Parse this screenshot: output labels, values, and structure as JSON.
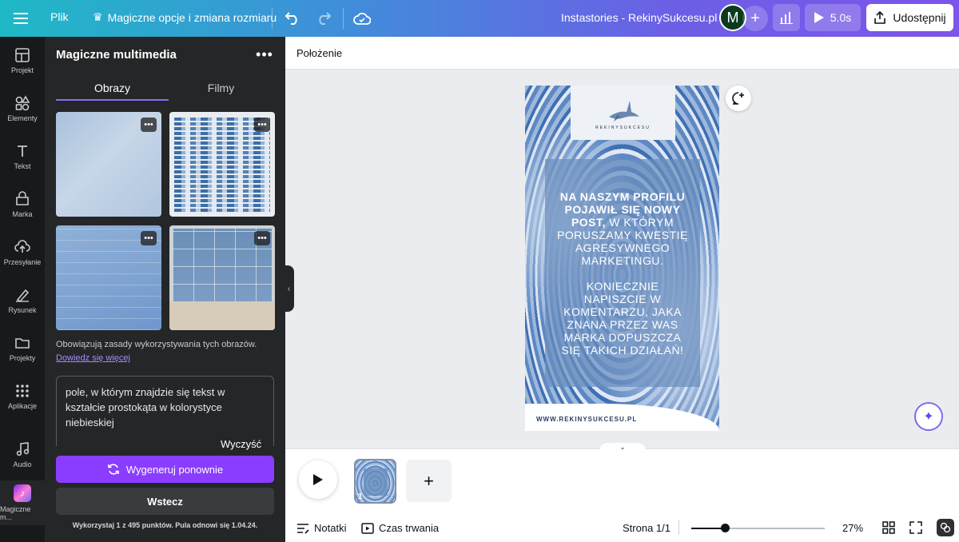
{
  "topbar": {
    "file_label": "Plik",
    "magic_label": "Magiczne opcje i zmiana rozmiaru",
    "doc_title": "Instastories - RekinySukcesu.pl",
    "avatar_initial": "M",
    "play_duration": "5.0s",
    "share_label": "Udostępnij"
  },
  "rail": {
    "items": [
      {
        "label": "Projekt",
        "icon": "layout-icon"
      },
      {
        "label": "Elementy",
        "icon": "shapes-icon"
      },
      {
        "label": "Tekst",
        "icon": "text-icon"
      },
      {
        "label": "Marka",
        "icon": "brand-icon"
      },
      {
        "label": "Przesyłanie",
        "icon": "upload-icon"
      },
      {
        "label": "Rysunek",
        "icon": "draw-icon"
      },
      {
        "label": "Projekty",
        "icon": "folder-icon"
      },
      {
        "label": "Aplikacje",
        "icon": "apps-icon"
      },
      {
        "label": "Audio",
        "icon": "music-icon"
      },
      {
        "label": "Magiczne m...",
        "icon": "magic-media-icon"
      }
    ]
  },
  "panel": {
    "title": "Magiczne multimedia",
    "tabs": [
      "Obrazy",
      "Filmy"
    ],
    "active_tab": "Obrazy",
    "notice": "Obowiązują zasady wykorzystywania tych obrazów.",
    "learn_more": "Dowiedz się więcej",
    "prompt": "pole, w którym znajdzie się tekst w kształcie prostokąta w kolorystyce niebieskiej",
    "clear_label": "Wyczyść",
    "regenerate_label": "Wygeneruj ponownie",
    "back_label": "Wstecz",
    "credits": "Wykorzystaj 1 z 495 punktów. Pula odnowi się 1.04.24."
  },
  "context_bar": {
    "position_label": "Położenie"
  },
  "design": {
    "logo_text": "REKINYSUKCESU",
    "card_bold": "NA NASZYM PROFILU POJAWIŁ SIĘ NOWY POST,",
    "card_regular": " W KTÓRYM PORUSZAMY KWESTIĘ AGRESYWNEGO MARKETINGU.",
    "card_second": "KONIECZNIE NAPISZCIE W KOMENTARZU, JAKA ZNANA PRZEZ WAS MARKA DOPUSZCZA SIĘ TAKICH DZIAŁAŃ!",
    "url": "WWW.REKINYSUKCESU.PL"
  },
  "pages": {
    "current_page_number": "1",
    "add_label": "+"
  },
  "footer": {
    "notes_label": "Notatki",
    "duration_label": "Czas trwania",
    "page_count": "Strona 1/1",
    "zoom_value": "27%",
    "zoom_fraction": 0.25
  },
  "colors": {
    "accent": "#8b3dff",
    "panel_bg": "#252627",
    "rail_bg": "#18191b"
  }
}
